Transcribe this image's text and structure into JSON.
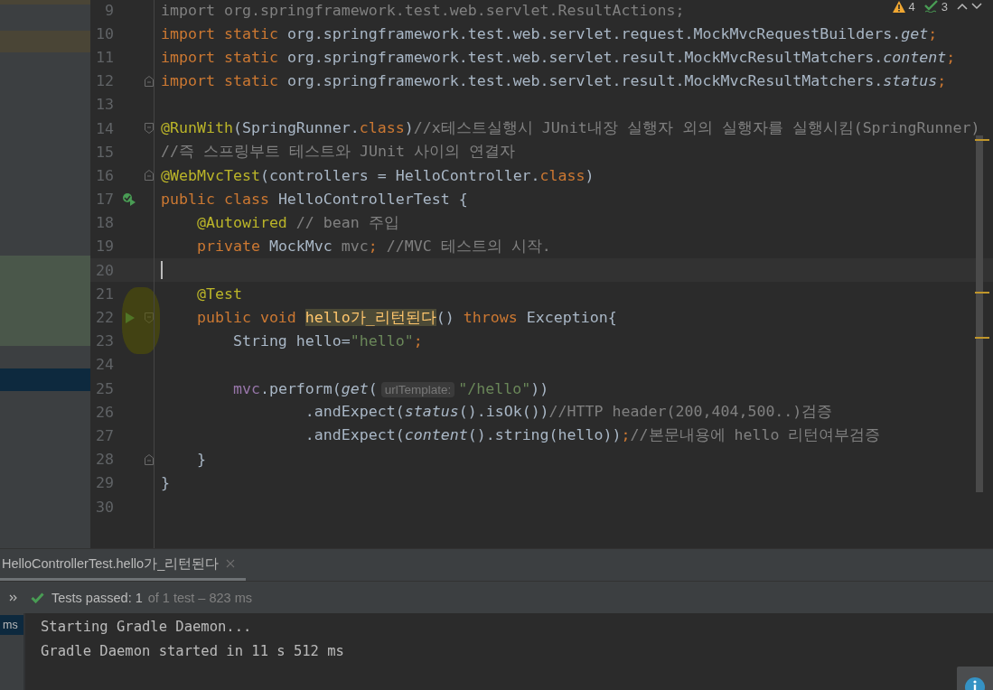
{
  "editor": {
    "inspections": {
      "warnings": "4",
      "checks": "3"
    },
    "lines": [
      {
        "number": "9",
        "current": false,
        "tokens": [
          {
            "kind": "dim",
            "text": "import org.springframework.test.web.servlet.ResultActions;"
          }
        ]
      },
      {
        "number": "10",
        "current": false,
        "tokens": [
          {
            "kind": "keyword",
            "text": "import static "
          },
          {
            "kind": "plain",
            "text": "org.springframework.test.web.servlet.request.MockMvcRequestBuilders."
          },
          {
            "kind": "italic",
            "text": "get"
          },
          {
            "kind": "keyword",
            "text": ";"
          }
        ]
      },
      {
        "number": "11",
        "current": false,
        "tokens": [
          {
            "kind": "keyword",
            "text": "import static "
          },
          {
            "kind": "plain",
            "text": "org.springframework.test.web.servlet.result.MockMvcResultMatchers."
          },
          {
            "kind": "italic",
            "text": "content"
          },
          {
            "kind": "keyword",
            "text": ";"
          }
        ]
      },
      {
        "number": "12",
        "current": false,
        "markers": [
          {
            "kind": "fold-end"
          }
        ],
        "tokens": [
          {
            "kind": "keyword",
            "text": "import static "
          },
          {
            "kind": "plain",
            "text": "org.springframework.test.web.servlet.result.MockMvcResultMatchers."
          },
          {
            "kind": "italic",
            "text": "status"
          },
          {
            "kind": "keyword",
            "text": ";"
          }
        ]
      },
      {
        "number": "13",
        "current": false
      },
      {
        "number": "14",
        "current": false,
        "markers": [
          {
            "kind": "fold-start"
          }
        ],
        "tokens": [
          {
            "kind": "annotation",
            "text": "@RunWith"
          },
          {
            "kind": "plain",
            "text": "(SpringRunner."
          },
          {
            "kind": "keyword",
            "text": "class"
          },
          {
            "kind": "plain",
            "text": ")"
          },
          {
            "kind": "comment",
            "text": "//x테스트실행시 JUnit내장 실행자 외의 실행자를 실행시킴(SpringRunner)"
          }
        ]
      },
      {
        "number": "15",
        "current": false,
        "tokens": [
          {
            "kind": "comment",
            "text": "//즉 스프링부트 테스트와 JUnit 사이의 연결자"
          }
        ]
      },
      {
        "number": "16",
        "current": false,
        "markers": [
          {
            "kind": "fold-end"
          }
        ],
        "tokens": [
          {
            "kind": "annotation",
            "text": "@WebMvcTest"
          },
          {
            "kind": "plain",
            "text": "(controllers = HelloController."
          },
          {
            "kind": "keyword",
            "text": "class"
          },
          {
            "kind": "plain",
            "text": ")"
          }
        ]
      },
      {
        "number": "17",
        "current": false,
        "markers": [
          {
            "kind": "run-class"
          }
        ],
        "tokens": [
          {
            "kind": "keyword",
            "text": "public class "
          },
          {
            "kind": "plain",
            "text": "HelloControllerTest {"
          }
        ]
      },
      {
        "number": "18",
        "current": false,
        "tokens": [
          {
            "kind": "annotation",
            "text": "    @Autowired"
          },
          {
            "kind": "comment",
            "text": " // bean 주입"
          }
        ]
      },
      {
        "number": "19",
        "current": false,
        "tokens": [
          {
            "kind": "keyword",
            "text": "    private "
          },
          {
            "kind": "plain",
            "text": "MockMvc "
          },
          {
            "kind": "dim",
            "text": "mvc"
          },
          {
            "kind": "keyword",
            "text": ";"
          },
          {
            "kind": "comment",
            "text": " //MVC 테스트의 시작."
          }
        ]
      },
      {
        "number": "20",
        "current": true
      },
      {
        "number": "21",
        "current": false,
        "tokens": [
          {
            "kind": "annotation",
            "text": "    @Test"
          }
        ]
      },
      {
        "number": "22",
        "current": false,
        "markers": [
          {
            "kind": "run"
          },
          {
            "kind": "fold-start"
          }
        ],
        "tokens": [
          {
            "kind": "keyword",
            "text": "    public void "
          },
          {
            "kind": "method",
            "text": "hello가_리턴된다"
          },
          {
            "kind": "plain",
            "text": "() "
          },
          {
            "kind": "keyword",
            "text": "throws "
          },
          {
            "kind": "plain",
            "text": "Exception{"
          }
        ]
      },
      {
        "number": "23",
        "current": false,
        "tokens": [
          {
            "kind": "plain",
            "text": "        String hello="
          },
          {
            "kind": "string",
            "text": "\"hello\""
          },
          {
            "kind": "keyword",
            "text": ";"
          }
        ]
      },
      {
        "number": "24",
        "current": false
      },
      {
        "number": "25",
        "current": false,
        "tokens": [
          {
            "kind": "field",
            "text": "        mvc"
          },
          {
            "kind": "plain",
            "text": ".perform("
          },
          {
            "kind": "italic",
            "text": "get"
          },
          {
            "kind": "plain",
            "text": "("
          },
          {
            "kind": "hint",
            "text": "urlTemplate:"
          },
          {
            "kind": "string",
            "text": "\"/hello\""
          },
          {
            "kind": "plain",
            "text": "))"
          }
        ]
      },
      {
        "number": "26",
        "current": false,
        "tokens": [
          {
            "kind": "plain",
            "text": "                .andExpect("
          },
          {
            "kind": "italic",
            "text": "status"
          },
          {
            "kind": "plain",
            "text": "().isOk())"
          },
          {
            "kind": "comment",
            "text": "//HTTP header(200,404,500..)검증"
          }
        ]
      },
      {
        "number": "27",
        "current": false,
        "tokens": [
          {
            "kind": "plain",
            "text": "                .andExpect("
          },
          {
            "kind": "italic",
            "text": "content"
          },
          {
            "kind": "plain",
            "text": "().string(hello))"
          },
          {
            "kind": "keyword",
            "text": ";"
          },
          {
            "kind": "comment",
            "text": "//본문내용에 hello 리턴여부검증"
          }
        ]
      },
      {
        "number": "28",
        "current": false,
        "markers": [
          {
            "kind": "fold-end"
          }
        ],
        "tokens": [
          {
            "kind": "plain",
            "text": "    }"
          }
        ]
      },
      {
        "number": "29",
        "current": false,
        "tokens": [
          {
            "kind": "plain",
            "text": "}"
          }
        ]
      },
      {
        "number": "30",
        "current": false
      }
    ]
  },
  "run_panel": {
    "tabs": [
      {
        "label": "HelloControllerTest.hello가_리턴된다",
        "selected": true
      }
    ],
    "status": "Tests passed: 1",
    "detail": "of 1 test – 823 ms",
    "side_label": "ms",
    "console": [
      "Starting Gradle Daemon...",
      "Gradle Daemon started in 11 s 512 ms"
    ]
  }
}
